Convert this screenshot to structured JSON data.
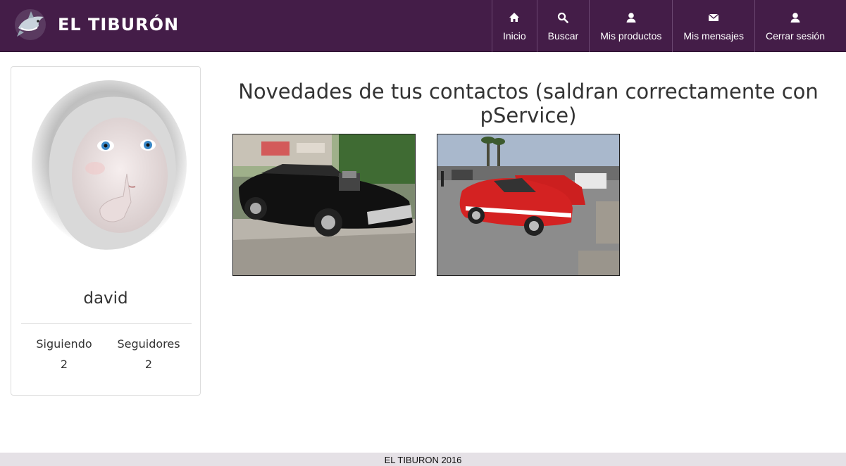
{
  "brand": {
    "name": "EL TIBURÓN",
    "logo_icon": "shark-icon"
  },
  "nav": {
    "items": [
      {
        "label": "Inicio",
        "icon": "home-icon"
      },
      {
        "label": "Buscar",
        "icon": "search-icon"
      },
      {
        "label": "Mis productos",
        "icon": "user-icon"
      },
      {
        "label": "Mis mensajes",
        "icon": "envelope-icon"
      },
      {
        "label": "Cerrar sesión",
        "icon": "user-icon"
      }
    ]
  },
  "profile": {
    "username": "david",
    "following_label": "Siguiendo",
    "following_count": "2",
    "followers_label": "Seguidores",
    "followers_count": "2"
  },
  "main": {
    "title": "Novedades de tus contactos (saldran correctamente con pService)",
    "photos": [
      {
        "subject": "black muscle car"
      },
      {
        "subject": "red muscle car"
      }
    ]
  },
  "footer": {
    "text": "EL TIBURON 2016"
  },
  "colors": {
    "navbar": "#441d48",
    "footer": "#e5e1e6"
  }
}
